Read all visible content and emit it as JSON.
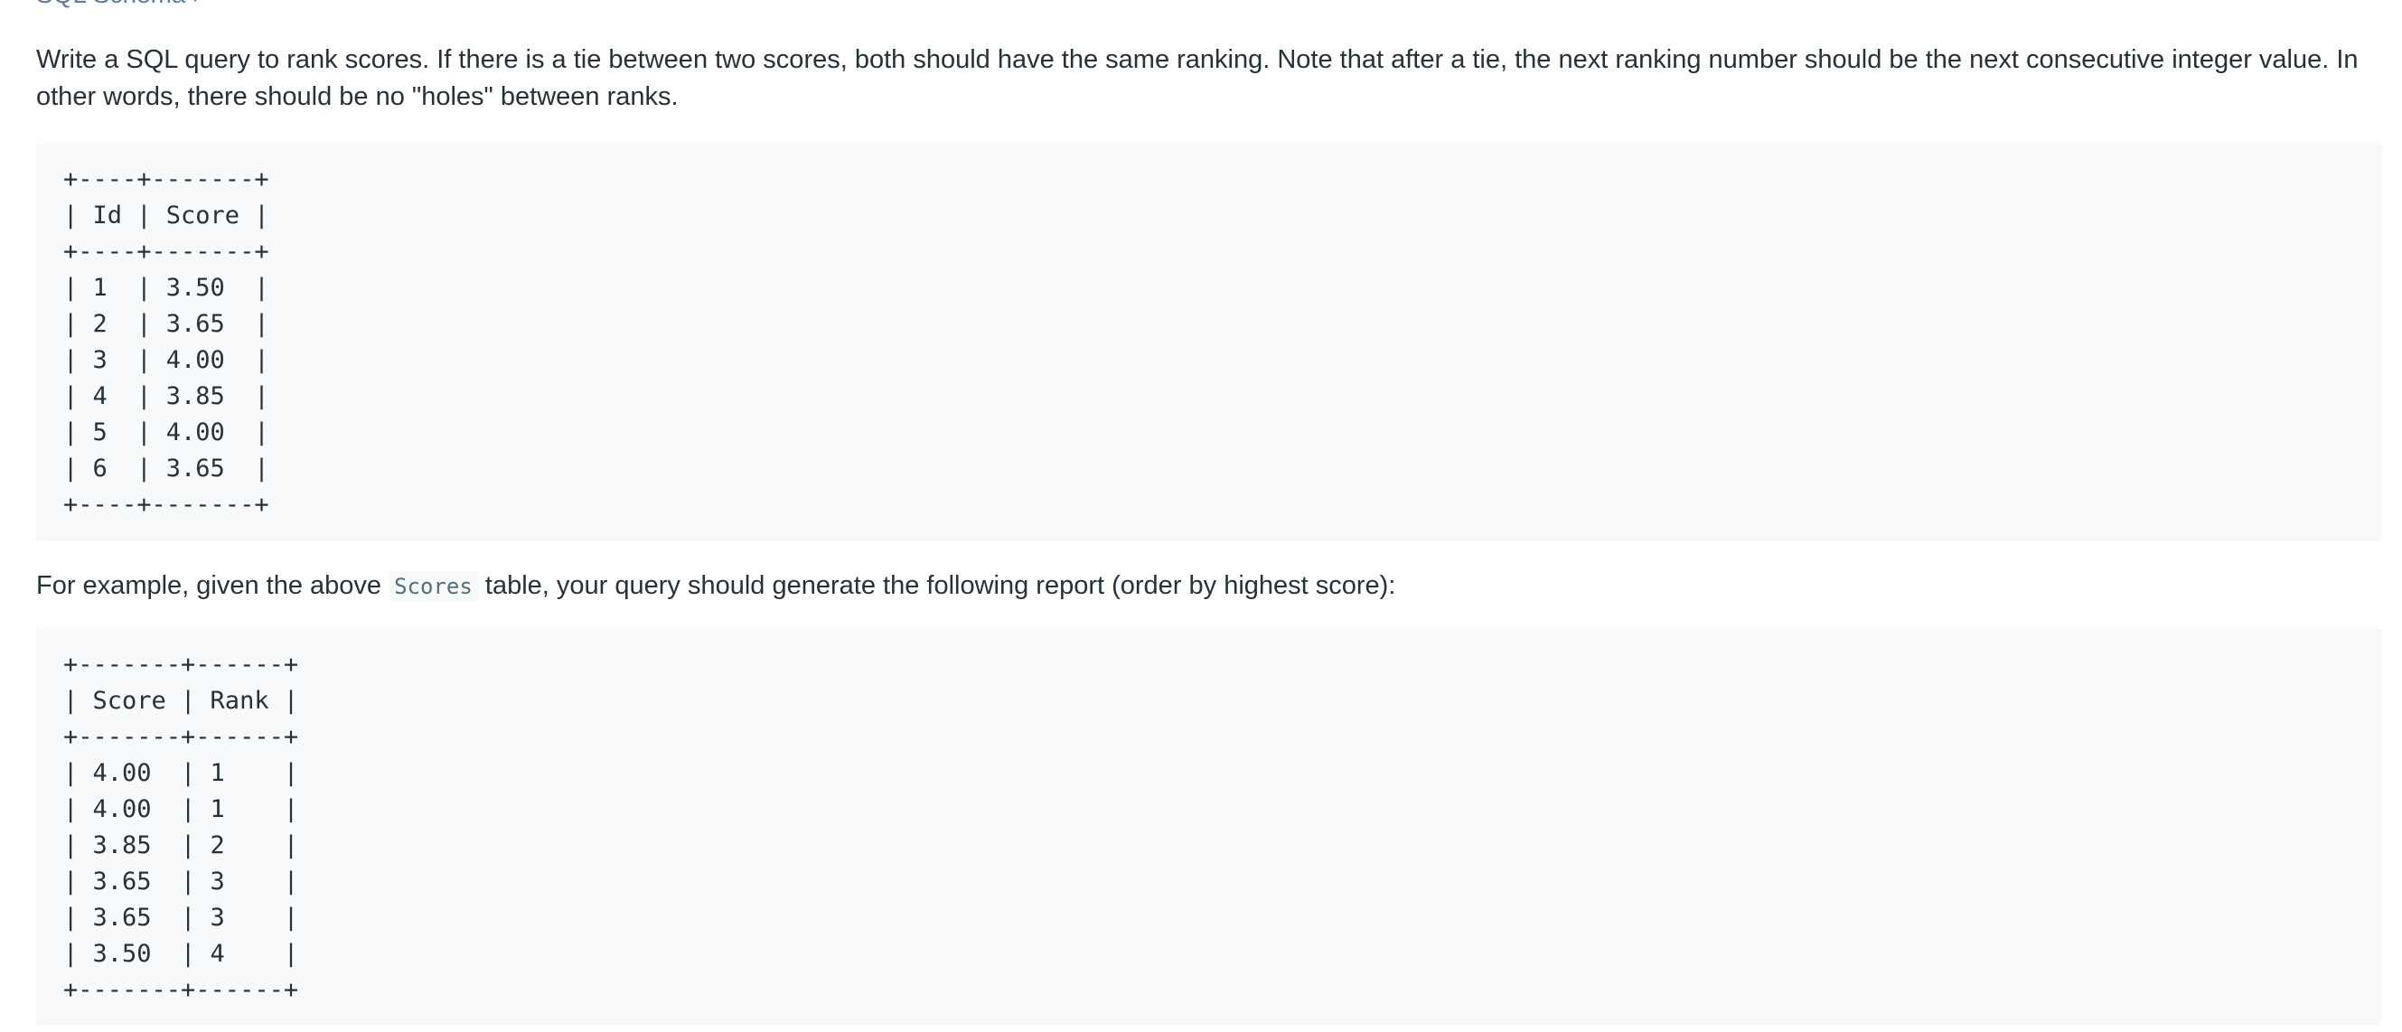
{
  "schema_link": {
    "label": "SQL Schema",
    "icon": "chevron-right-icon"
  },
  "description": "Write a SQL query to rank scores. If there is a tie between two scores, both should have the same ranking. Note that after a tie, the next ranking number should be the next consecutive integer value. In other words, there should be no \"holes\" between ranks.",
  "input_table": "+----+-------+\n| Id | Score |\n+----+-------+\n| 1  | 3.50  |\n| 2  | 3.65  |\n| 3  | 4.00  |\n| 4  | 3.85  |\n| 5  | 4.00  |\n| 6  | 3.65  |\n+----+-------+",
  "example": {
    "prefix": "For example, given the above",
    "code": "Scores",
    "suffix": "table, your query should generate the following report (order by highest score):"
  },
  "output_table": "+-------+------+\n| Score | Rank |\n+-------+------+\n| 4.00  | 1    |\n| 4.00  | 1    |\n| 3.85  | 2    |\n| 3.65  | 3    |\n| 3.65  | 3    |\n| 3.50  | 4    |\n+-------+------+",
  "colors": {
    "text": "#263238",
    "link": "#607d9b",
    "code_background": "#f7f9fa"
  }
}
